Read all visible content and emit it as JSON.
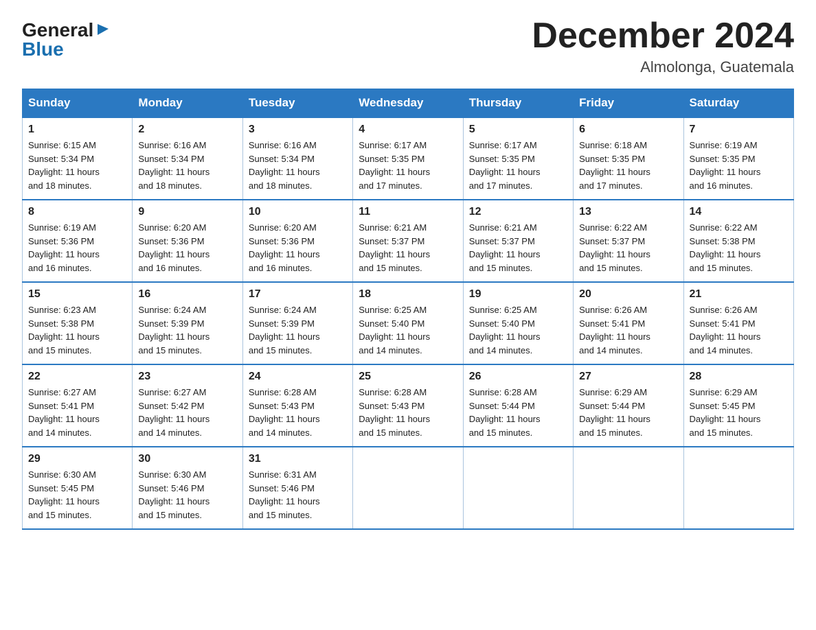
{
  "logo": {
    "general": "General",
    "blue": "Blue",
    "triangle": "▶"
  },
  "title": "December 2024",
  "subtitle": "Almolonga, Guatemala",
  "days_of_week": [
    "Sunday",
    "Monday",
    "Tuesday",
    "Wednesday",
    "Thursday",
    "Friday",
    "Saturday"
  ],
  "weeks": [
    [
      {
        "num": "1",
        "sunrise": "Sunrise: 6:15 AM",
        "sunset": "Sunset: 5:34 PM",
        "daylight": "Daylight: 11 hours and 18 minutes."
      },
      {
        "num": "2",
        "sunrise": "Sunrise: 6:16 AM",
        "sunset": "Sunset: 5:34 PM",
        "daylight": "Daylight: 11 hours and 18 minutes."
      },
      {
        "num": "3",
        "sunrise": "Sunrise: 6:16 AM",
        "sunset": "Sunset: 5:34 PM",
        "daylight": "Daylight: 11 hours and 18 minutes."
      },
      {
        "num": "4",
        "sunrise": "Sunrise: 6:17 AM",
        "sunset": "Sunset: 5:35 PM",
        "daylight": "Daylight: 11 hours and 17 minutes."
      },
      {
        "num": "5",
        "sunrise": "Sunrise: 6:17 AM",
        "sunset": "Sunset: 5:35 PM",
        "daylight": "Daylight: 11 hours and 17 minutes."
      },
      {
        "num": "6",
        "sunrise": "Sunrise: 6:18 AM",
        "sunset": "Sunset: 5:35 PM",
        "daylight": "Daylight: 11 hours and 17 minutes."
      },
      {
        "num": "7",
        "sunrise": "Sunrise: 6:19 AM",
        "sunset": "Sunset: 5:35 PM",
        "daylight": "Daylight: 11 hours and 16 minutes."
      }
    ],
    [
      {
        "num": "8",
        "sunrise": "Sunrise: 6:19 AM",
        "sunset": "Sunset: 5:36 PM",
        "daylight": "Daylight: 11 hours and 16 minutes."
      },
      {
        "num": "9",
        "sunrise": "Sunrise: 6:20 AM",
        "sunset": "Sunset: 5:36 PM",
        "daylight": "Daylight: 11 hours and 16 minutes."
      },
      {
        "num": "10",
        "sunrise": "Sunrise: 6:20 AM",
        "sunset": "Sunset: 5:36 PM",
        "daylight": "Daylight: 11 hours and 16 minutes."
      },
      {
        "num": "11",
        "sunrise": "Sunrise: 6:21 AM",
        "sunset": "Sunset: 5:37 PM",
        "daylight": "Daylight: 11 hours and 15 minutes."
      },
      {
        "num": "12",
        "sunrise": "Sunrise: 6:21 AM",
        "sunset": "Sunset: 5:37 PM",
        "daylight": "Daylight: 11 hours and 15 minutes."
      },
      {
        "num": "13",
        "sunrise": "Sunrise: 6:22 AM",
        "sunset": "Sunset: 5:37 PM",
        "daylight": "Daylight: 11 hours and 15 minutes."
      },
      {
        "num": "14",
        "sunrise": "Sunrise: 6:22 AM",
        "sunset": "Sunset: 5:38 PM",
        "daylight": "Daylight: 11 hours and 15 minutes."
      }
    ],
    [
      {
        "num": "15",
        "sunrise": "Sunrise: 6:23 AM",
        "sunset": "Sunset: 5:38 PM",
        "daylight": "Daylight: 11 hours and 15 minutes."
      },
      {
        "num": "16",
        "sunrise": "Sunrise: 6:24 AM",
        "sunset": "Sunset: 5:39 PM",
        "daylight": "Daylight: 11 hours and 15 minutes."
      },
      {
        "num": "17",
        "sunrise": "Sunrise: 6:24 AM",
        "sunset": "Sunset: 5:39 PM",
        "daylight": "Daylight: 11 hours and 15 minutes."
      },
      {
        "num": "18",
        "sunrise": "Sunrise: 6:25 AM",
        "sunset": "Sunset: 5:40 PM",
        "daylight": "Daylight: 11 hours and 14 minutes."
      },
      {
        "num": "19",
        "sunrise": "Sunrise: 6:25 AM",
        "sunset": "Sunset: 5:40 PM",
        "daylight": "Daylight: 11 hours and 14 minutes."
      },
      {
        "num": "20",
        "sunrise": "Sunrise: 6:26 AM",
        "sunset": "Sunset: 5:41 PM",
        "daylight": "Daylight: 11 hours and 14 minutes."
      },
      {
        "num": "21",
        "sunrise": "Sunrise: 6:26 AM",
        "sunset": "Sunset: 5:41 PM",
        "daylight": "Daylight: 11 hours and 14 minutes."
      }
    ],
    [
      {
        "num": "22",
        "sunrise": "Sunrise: 6:27 AM",
        "sunset": "Sunset: 5:41 PM",
        "daylight": "Daylight: 11 hours and 14 minutes."
      },
      {
        "num": "23",
        "sunrise": "Sunrise: 6:27 AM",
        "sunset": "Sunset: 5:42 PM",
        "daylight": "Daylight: 11 hours and 14 minutes."
      },
      {
        "num": "24",
        "sunrise": "Sunrise: 6:28 AM",
        "sunset": "Sunset: 5:43 PM",
        "daylight": "Daylight: 11 hours and 14 minutes."
      },
      {
        "num": "25",
        "sunrise": "Sunrise: 6:28 AM",
        "sunset": "Sunset: 5:43 PM",
        "daylight": "Daylight: 11 hours and 15 minutes."
      },
      {
        "num": "26",
        "sunrise": "Sunrise: 6:28 AM",
        "sunset": "Sunset: 5:44 PM",
        "daylight": "Daylight: 11 hours and 15 minutes."
      },
      {
        "num": "27",
        "sunrise": "Sunrise: 6:29 AM",
        "sunset": "Sunset: 5:44 PM",
        "daylight": "Daylight: 11 hours and 15 minutes."
      },
      {
        "num": "28",
        "sunrise": "Sunrise: 6:29 AM",
        "sunset": "Sunset: 5:45 PM",
        "daylight": "Daylight: 11 hours and 15 minutes."
      }
    ],
    [
      {
        "num": "29",
        "sunrise": "Sunrise: 6:30 AM",
        "sunset": "Sunset: 5:45 PM",
        "daylight": "Daylight: 11 hours and 15 minutes."
      },
      {
        "num": "30",
        "sunrise": "Sunrise: 6:30 AM",
        "sunset": "Sunset: 5:46 PM",
        "daylight": "Daylight: 11 hours and 15 minutes."
      },
      {
        "num": "31",
        "sunrise": "Sunrise: 6:31 AM",
        "sunset": "Sunset: 5:46 PM",
        "daylight": "Daylight: 11 hours and 15 minutes."
      },
      null,
      null,
      null,
      null
    ]
  ]
}
